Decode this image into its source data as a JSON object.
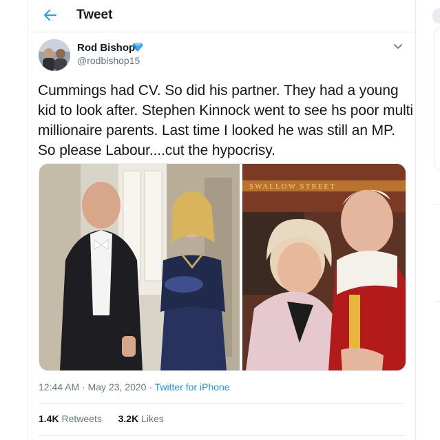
{
  "header": {
    "title": "Tweet",
    "back_icon": "arrow-left-icon"
  },
  "author": {
    "name": "Rod Bishop",
    "handle": "@rodbishop15",
    "badge_icon": "verified-diamond-icon",
    "menu_icon": "chevron-down-icon"
  },
  "tweet": {
    "text": "Cummings had CV. So did his partner. They had a young kid to look after. Stephen Kinnock went to see hs poor multi millionaire parents. Last time I looked he was still an MP. So please Labour....cut the hypocrisy.",
    "time": "12:44 AM",
    "separator": "·",
    "date": "May 23, 2020",
    "source": "Twitter for iPhone"
  },
  "stats": {
    "retweets_count": "1.4K",
    "retweets_label": "Retweets",
    "likes_count": "3.2K",
    "likes_label": "Likes"
  },
  "media": {
    "left_photo_sign": "",
    "right_photo_sign": "SWALLOW STREET"
  },
  "colors": {
    "accent": "#1da1f2",
    "link": "#1b95e0",
    "secondary_text": "#657786",
    "border": "#e6ecf0"
  }
}
